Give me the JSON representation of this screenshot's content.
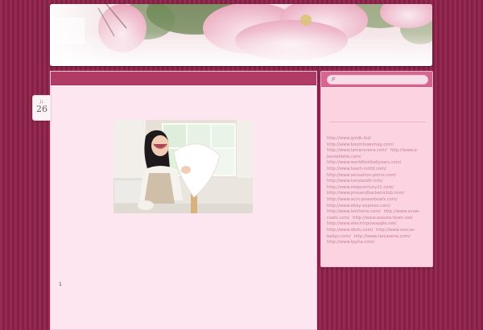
{
  "post": {
    "date_month": "JL",
    "date_day": "26",
    "page_number": "1"
  },
  "search": {
    "placeholder": ""
  },
  "sidebar": {
    "links": [
      "http://www.goldk.biz/",
      "http://www.boomtownmag.com/",
      "http://www.lamansnera.com/",
      "http://www.e-barzatlette.com/",
      "http://www.worldfootballyears.com/",
      "http://www.teach-cottd.com/",
      "http://www.sensation-porno.com/",
      "http://www.tonybooth.info/",
      "http://www.shopcentury21.com/",
      "http://www.prosandhackersclub.com/",
      "http://www.acm-powerboats.com/",
      "http://www.ebay-express.com/",
      "http://www.letcheria.com/",
      "http://www.snow-coats.com/",
      "http://www.wasota-town.net/",
      "http://www.electricpineapple.net/",
      "http://www.dtsfu.com/",
      "http://www.rescue-babys.com/",
      "http://www.tarcasena.com/",
      "http://www.tpyha.com/"
    ]
  },
  "colors": {
    "page_background": "#8e2149",
    "content_background": "#fde6ef",
    "sidebar_background": "#fcd3e1",
    "link_color": "#c4809b"
  },
  "icons": {
    "search": "magnifier-icon"
  }
}
